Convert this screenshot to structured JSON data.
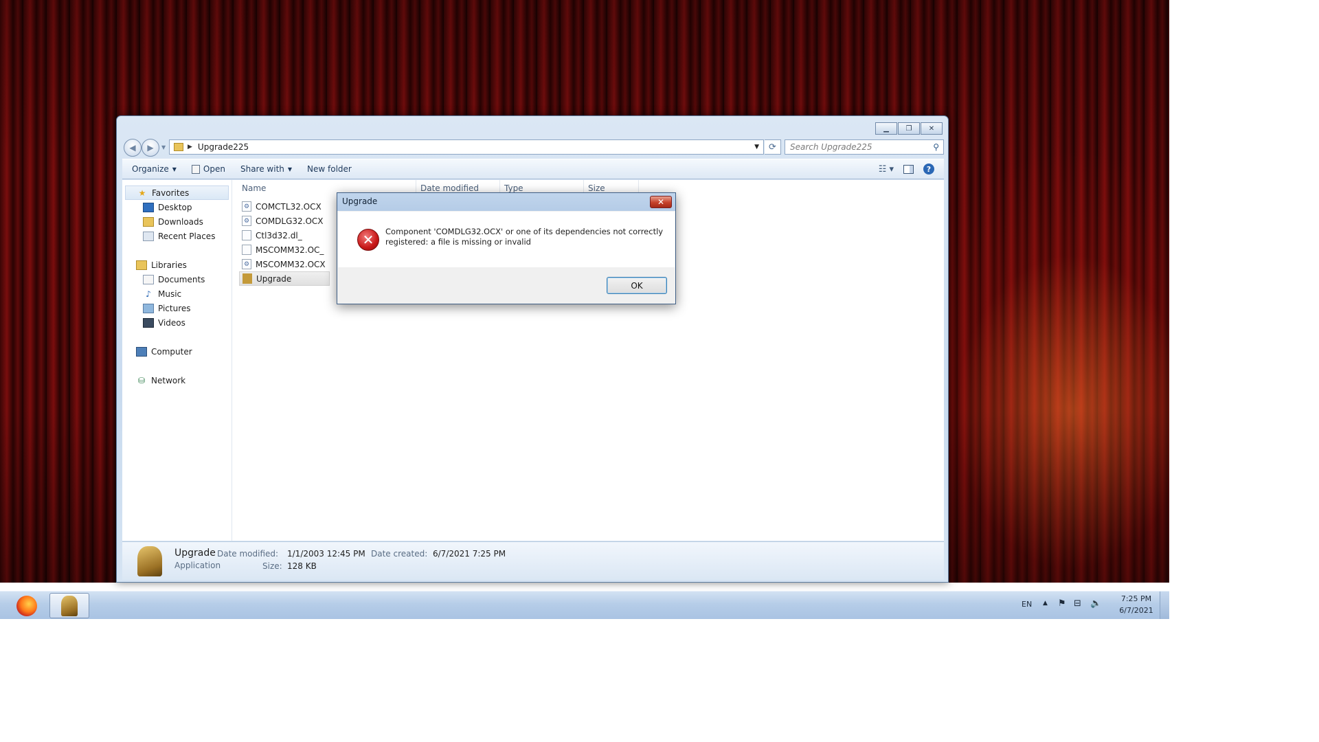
{
  "explorer": {
    "breadcrumb": "Upgrade225",
    "search_placeholder": "Search Upgrade225",
    "toolbar": {
      "organize": "Organize",
      "open": "Open",
      "share_with": "Share with",
      "new_folder": "New folder"
    },
    "nav_pane": {
      "favorites": "Favorites",
      "desktop": "Desktop",
      "downloads": "Downloads",
      "recent_places": "Recent Places",
      "libraries": "Libraries",
      "documents": "Documents",
      "music": "Music",
      "pictures": "Pictures",
      "videos": "Videos",
      "computer": "Computer",
      "network": "Network"
    },
    "columns": {
      "name": "Name",
      "date_modified": "Date modified",
      "type": "Type",
      "size": "Size"
    },
    "files": [
      "COMCTL32.OCX",
      "COMDLG32.OCX",
      "Ctl3d32.dl_",
      "MSCOMM32.OC_",
      "MSCOMM32.OCX",
      "Upgrade"
    ],
    "details": {
      "name": "Upgrade",
      "kind": "Application",
      "date_modified_label": "Date modified:",
      "date_modified": "1/1/2003 12:45 PM",
      "size_label": "Size:",
      "size": "128 KB",
      "date_created_label": "Date created:",
      "date_created": "6/7/2021 7:25 PM"
    }
  },
  "dialog": {
    "title": "Upgrade",
    "message": "Component 'COMDLG32.OCX' or one of its dependencies not correctly registered: a file is missing or invalid",
    "ok_label": "OK"
  },
  "taskbar": {
    "language": "EN",
    "time": "7:25 PM",
    "date": "6/7/2021"
  },
  "icons": {
    "back": "back-arrow-icon",
    "forward": "forward-arrow-icon",
    "error": "error-x-icon",
    "firefox": "firefox-icon"
  }
}
